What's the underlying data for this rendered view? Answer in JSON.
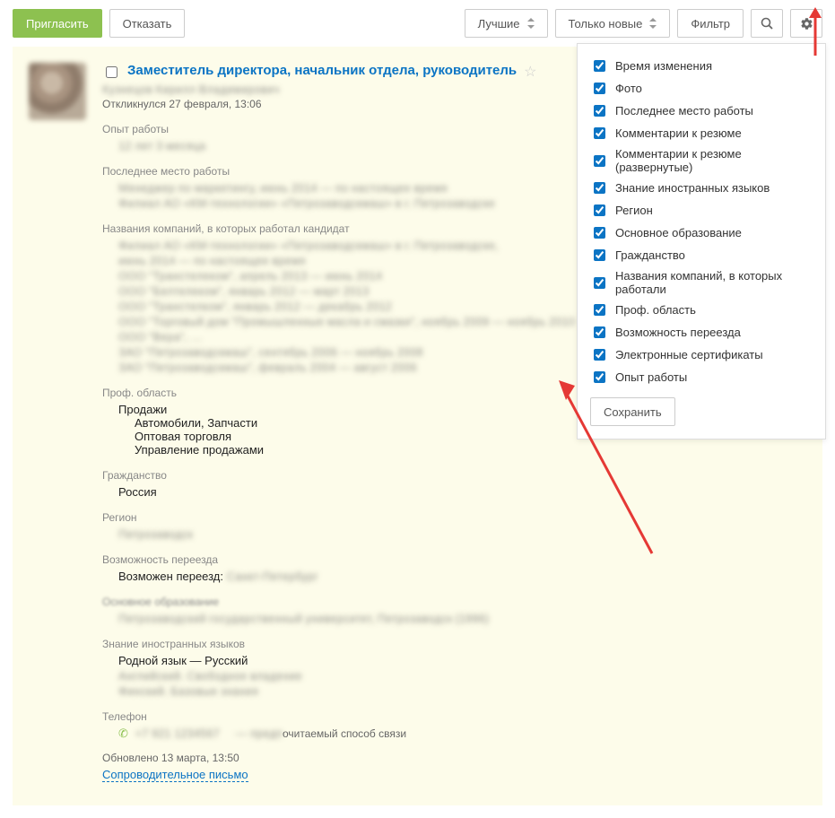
{
  "toolbar": {
    "invite_label": "Пригласить",
    "decline_label": "Отказать",
    "best_label": "Лучшие",
    "only_new_label": "Только новые",
    "filter_label": "Фильтр"
  },
  "resume": {
    "title": "Заместитель директора, начальник отдела, руководитель",
    "responded_text": "Откликнулся 27 февраля, 13:06",
    "experience_label": "Опыт работы",
    "last_workplace_label": "Последнее место работы",
    "companies_label": "Названия компаний, в которых работал кандидат",
    "prof_area_label": "Проф. область",
    "prof_area_value": "Продажи",
    "prof_area_items": [
      "Автомобили, Запчасти",
      "Оптовая торговля",
      "Управление продажами"
    ],
    "citizenship_label": "Гражданство",
    "citizenship_value": "Россия",
    "region_label": "Регион",
    "relocation_label": "Возможность переезда",
    "relocation_value": "Возможен переезд:",
    "education_label": "Основное образование",
    "languages_label": "Знание иностранных языков",
    "languages_value": "Родной язык — Русский",
    "phone_label": "Телефон",
    "phone_preferred_suffix": "очитаемый способ связи",
    "updated_text": "Обновлено 13 марта, 13:50",
    "cover_letter_label": "Сопроводительное письмо"
  },
  "settings": {
    "items": [
      "Время изменения",
      "Фото",
      "Последнее место работы",
      "Комментарии к резюме",
      "Комментарии к резюме (развернутые)",
      "Знание иностранных языков",
      "Регион",
      "Основное образование",
      "Гражданство",
      "Названия компаний, в которых работали",
      "Проф. область",
      "Возможность переезда",
      "Электронные сертификаты",
      "Опыт работы"
    ],
    "save_label": "Сохранить"
  }
}
